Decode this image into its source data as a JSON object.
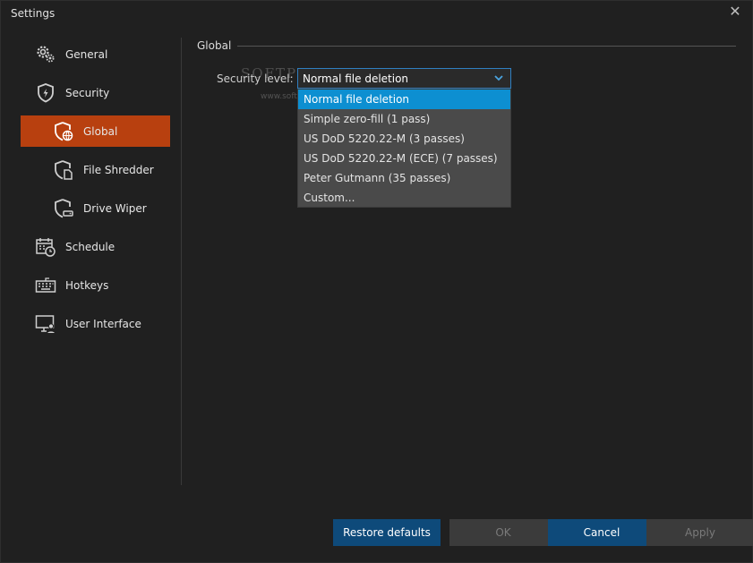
{
  "window": {
    "title": "Settings",
    "close_glyph": "✕"
  },
  "sidebar": {
    "items": [
      {
        "label": "General",
        "icon": "gear-icon"
      },
      {
        "label": "Security",
        "icon": "shield-icon"
      },
      {
        "label": "Global",
        "icon": "shield-globe-icon",
        "active": true
      },
      {
        "label": "File Shredder",
        "icon": "shield-file-icon"
      },
      {
        "label": "Drive Wiper",
        "icon": "shield-drive-icon"
      },
      {
        "label": "Schedule",
        "icon": "calendar-clock-icon"
      },
      {
        "label": "Hotkeys",
        "icon": "keyboard-icon"
      },
      {
        "label": "User Interface",
        "icon": "monitor-user-icon"
      }
    ]
  },
  "content": {
    "section_title": "Global",
    "security_level_label": "Security level:",
    "security_level_value": "Normal file deletion",
    "watermark": "SOFTPEDIA",
    "watermark_url": "www.softpedia.com",
    "options": [
      "Normal file deletion",
      "Simple zero-fill (1 pass)",
      "US DoD 5220.22-M (3 passes)",
      "US DoD 5220.22-M (ECE) (7 passes)",
      "Peter Gutmann (35 passes)",
      "Custom..."
    ]
  },
  "buttons": {
    "restore": "Restore defaults",
    "ok": "OK",
    "cancel": "Cancel",
    "apply": "Apply"
  },
  "colors": {
    "accent_active": "#b8400f",
    "dropdown_selected": "#0d8fd1",
    "primary_button": "#0e4a7a",
    "select_border": "#2f7fc1"
  }
}
